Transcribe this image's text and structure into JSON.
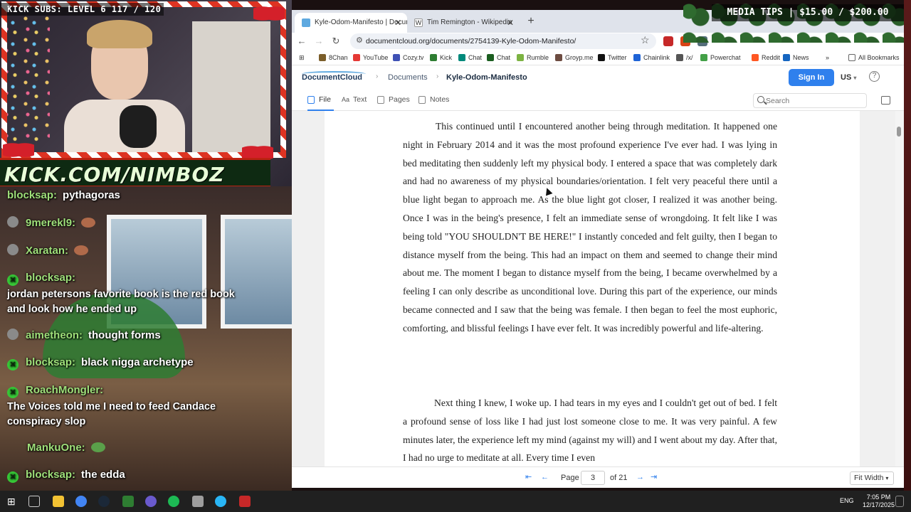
{
  "stream": {
    "sub_banner": "KICK SUBS: LEVEL 6 117 / 120",
    "kick_banner": "KICK.COM/NIMBOZ",
    "media_tips": "MEDIA TIPS | $15.00 / $200.00"
  },
  "chat": [
    {
      "user": "blocksap:",
      "message": "pythagoras"
    },
    {
      "user": "9merekl9:",
      "message": ""
    },
    {
      "user": "Xaratan:",
      "message": ""
    },
    {
      "user": "blocksap:",
      "message": "jordan petersons favorite book is the red book and look how he ended up"
    },
    {
      "user": "aimetheon:",
      "message": "thought forms"
    },
    {
      "user": "blocksap:",
      "message": "black nigga archetype"
    },
    {
      "user": "RoachMongler:",
      "message": "The Voices told me I need to feed Candace conspiracy slop"
    },
    {
      "user": "MankuOne:",
      "message": ""
    },
    {
      "user": "blocksap:",
      "message": "the edda"
    }
  ],
  "browser": {
    "tabs": [
      {
        "label": "Kyle-Odom-Manifesto | Docum",
        "active": true
      },
      {
        "label": "Tim Remington - Wikipedia",
        "active": false
      }
    ],
    "url": "documentcloud.org/documents/2754139-Kyle-Odom-Manifesto/",
    "bookmarks": [
      "8Chan",
      "YouTube",
      "Cozy.tv",
      "Kick",
      "Chat",
      "Chat",
      "Rumble",
      "Groyp.me",
      "Twitter",
      "Chainlink",
      "/x/",
      "Powerchat",
      "Reddit",
      "News",
      "All Bookmarks"
    ]
  },
  "dc": {
    "logo": "DocumentCloud",
    "crumb_docs": "Documents",
    "crumb_title": "Kyle-Odom-Manifesto",
    "signin": "Sign In",
    "lang": "US",
    "tabs": [
      "File",
      "Text",
      "Pages",
      "Notes"
    ],
    "search_placeholder": "Search",
    "page_label": "Page",
    "page_current": "3",
    "page_total": "of 21",
    "zoom": "Fit Width",
    "paragraph1": "This continued until I encountered another being through meditation. It happened one night in February 2014 and it was the most profound experience I've ever had. I was lying in bed meditating then suddenly left my physical body. I entered a space that was completely dark and had no awareness of my physical boundaries/orientation. I felt very peaceful there until a blue light began to approach me. As the blue light got closer, I realized it was another being. Once I was in the being's presence, I felt an immediate sense of wrongdoing. It felt like I was being told \"YOU SHOULDN'T BE HERE!\" I instantly conceded and felt guilty, then I began to distance myself from the being. This had an impact on them and seemed to change their mind about me. The moment I began to distance myself from the being, I became overwhelmed by a feeling I can only describe as unconditional love. During this part of the experience, our minds became connected and I saw that the being was female. I then began to feel the most euphoric, comforting, and blissful feelings I have ever felt. It was incredibly powerful and life-altering.",
    "paragraph2": "Next thing I knew, I woke up. I had tears in my eyes and I couldn't get out of bed. I felt a profound sense of loss like I had just lost someone close to me. It was very painful. A few minutes later, the experience left my mind (against my will) and I went about my day. After that, I had no urge to meditate at all. Every time I even"
  },
  "taskbar": {
    "lang": "ENG",
    "time": "7:05 PM",
    "date": "12/17/2025"
  }
}
